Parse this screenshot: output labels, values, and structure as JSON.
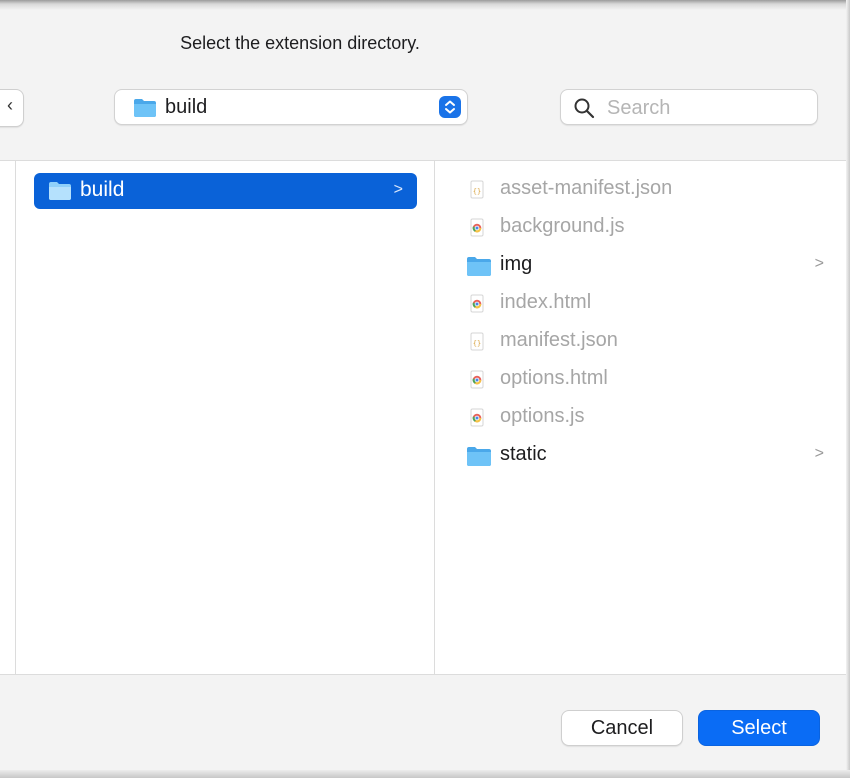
{
  "dialog": {
    "prompt": "Select the extension directory.",
    "back_glyph": "‹"
  },
  "toolbar": {
    "location_label": "build",
    "location_icon": "folder-icon",
    "stepper_icon": "chevron-up-down-icon",
    "search_icon": "magnifying-glass-icon",
    "search_placeholder": "Search",
    "search_value": ""
  },
  "browser": {
    "column1": {
      "selected_item": {
        "label": "build",
        "icon": "folder-icon",
        "chevron": ">"
      }
    },
    "column2": {
      "items": [
        {
          "label": "asset-manifest.json",
          "icon": "json-file-icon",
          "enabled": false
        },
        {
          "label": "background.js",
          "icon": "chrome-file-icon",
          "enabled": false
        },
        {
          "label": "img",
          "icon": "folder-icon",
          "enabled": true,
          "chevron": ">"
        },
        {
          "label": "index.html",
          "icon": "chrome-file-icon",
          "enabled": false
        },
        {
          "label": "manifest.json",
          "icon": "json-file-icon",
          "enabled": false
        },
        {
          "label": "options.html",
          "icon": "chrome-file-icon",
          "enabled": false
        },
        {
          "label": "options.js",
          "icon": "chrome-file-icon",
          "enabled": false
        },
        {
          "label": "static",
          "icon": "folder-icon",
          "enabled": true,
          "chevron": ">"
        }
      ]
    }
  },
  "footer": {
    "cancel_label": "Cancel",
    "select_label": "Select"
  },
  "colors": {
    "accent": "#0a6cf5",
    "selection": "#0a62d8",
    "folder": "#5cb8f5",
    "disabled_text": "#a6a6a6"
  }
}
